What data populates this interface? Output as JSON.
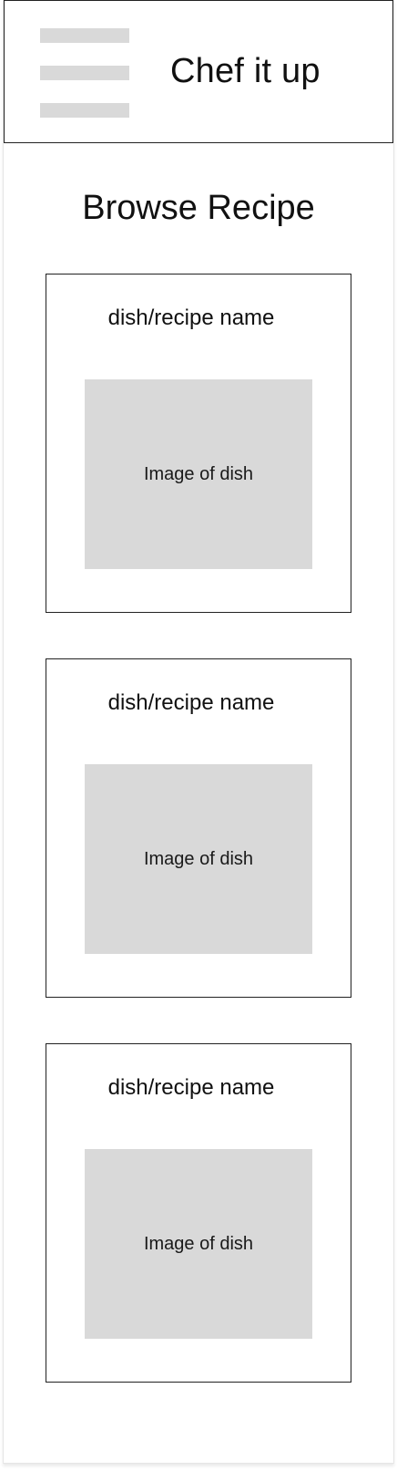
{
  "header": {
    "app_title": "Chef it up"
  },
  "main": {
    "page_title": "Browse Recipe",
    "recipes": [
      {
        "name": "dish/recipe name",
        "image_label": "Image of dish"
      },
      {
        "name": "dish/recipe name",
        "image_label": "Image of dish"
      },
      {
        "name": "dish/recipe name",
        "image_label": "Image of dish"
      }
    ]
  },
  "colors": {
    "placeholder_gray": "#d9d9d9",
    "border": "#222222",
    "text": "#111111",
    "background": "#ffffff"
  },
  "icons": {
    "menu": "hamburger-menu-icon"
  }
}
